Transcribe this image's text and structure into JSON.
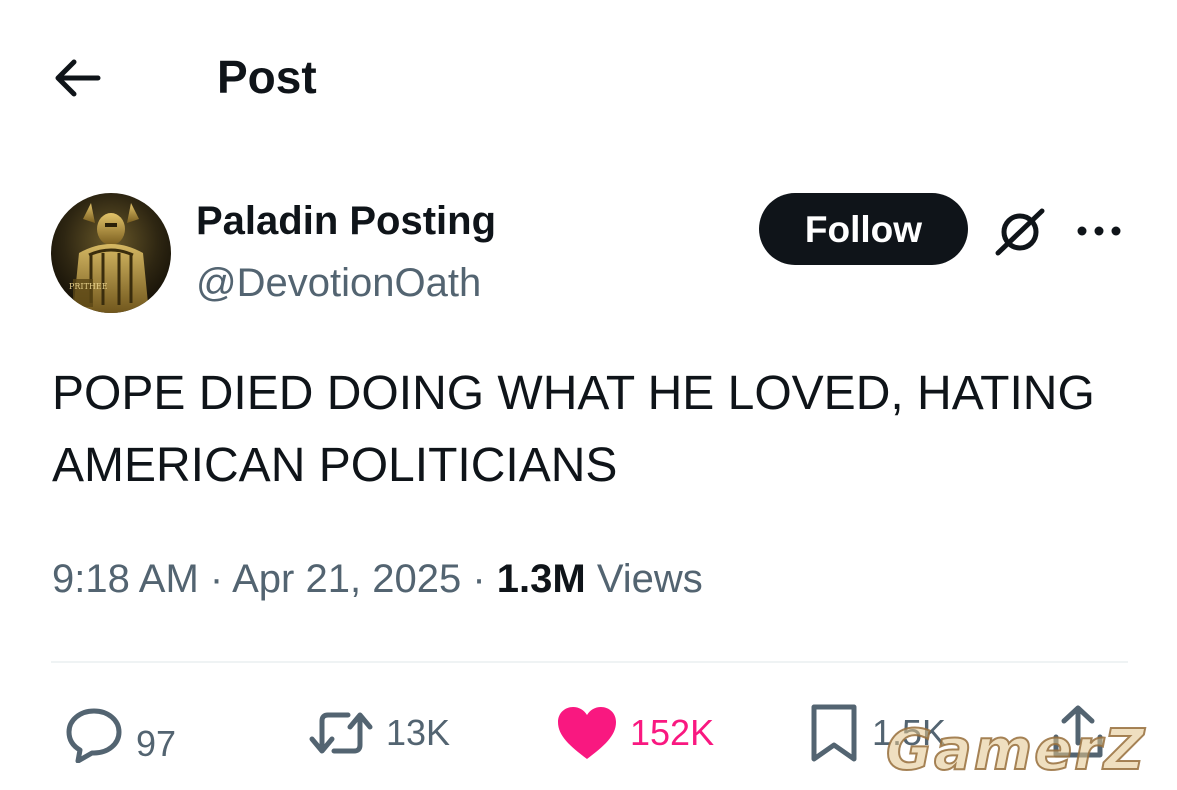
{
  "header": {
    "title": "Post",
    "back_icon": "arrow-left-icon"
  },
  "post": {
    "author": {
      "display_name": "Paladin Posting",
      "handle": "@DevotionOath",
      "avatar_caption": "PRITHEE"
    },
    "follow_label": "Follow",
    "grok_icon": "grok-icon",
    "more_icon": "more-horizontal-icon",
    "text": "POPE DIED DOING WHAT HE LOVED, HATING AMERICAN POLITICIANS",
    "time": "9:18 AM",
    "separator": "·",
    "date": "Apr 21, 2025",
    "views_count": "1.3M",
    "views_label": "Views"
  },
  "actions": {
    "replies": "97",
    "reposts": "13K",
    "likes": "152K",
    "bookmarks": "1.5K"
  },
  "watermark": "GamerZ",
  "colors": {
    "text": "#0f1419",
    "secondary": "#536471",
    "like": "#f91880",
    "follow_bg": "#0f1419",
    "divider": "#eff3f4"
  }
}
